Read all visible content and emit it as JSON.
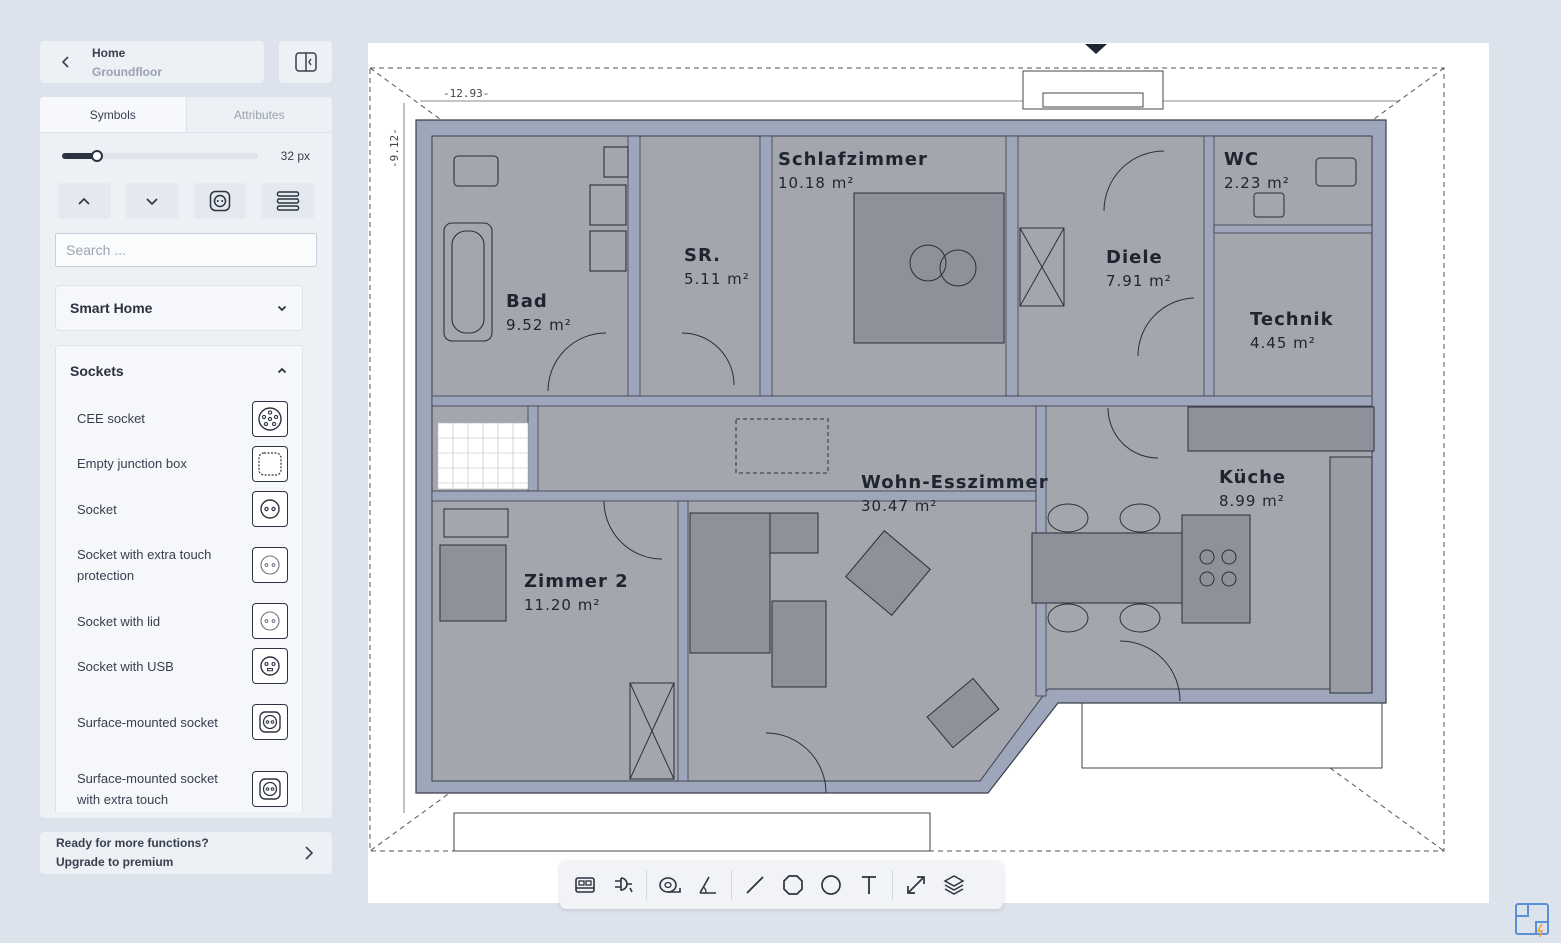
{
  "header": {
    "title": "Home",
    "subtitle": "Groundfloor"
  },
  "tabs": [
    {
      "label": "Symbols"
    },
    {
      "label": "Attributes"
    }
  ],
  "size_slider": {
    "value_label": "32 px",
    "level": 0.18
  },
  "search": {
    "placeholder": "Search ..."
  },
  "groups": {
    "smart_home": {
      "label": "Smart Home"
    },
    "sockets": {
      "label": "Sockets",
      "items": [
        {
          "label": "CEE socket"
        },
        {
          "label": "Empty junction box"
        },
        {
          "label": "Socket"
        },
        {
          "label": "Socket with extra touch protection"
        },
        {
          "label": "Socket with lid"
        },
        {
          "label": "Socket with USB"
        },
        {
          "label": "Surface-mounted socket"
        },
        {
          "label": "Surface-mounted socket with extra touch"
        }
      ]
    }
  },
  "upgrade": {
    "line1": "Ready for more functions?",
    "line2": "Upgrade to premium"
  },
  "floorplan": {
    "dimension_width": "-12.93-",
    "dimension_height": "-9.12-",
    "rooms": [
      {
        "name": "Schlafzimmer",
        "area": "10.18 m²"
      },
      {
        "name": "WC",
        "area": "2.23 m²"
      },
      {
        "name": "SR.",
        "area": "5.11 m²"
      },
      {
        "name": "Diele",
        "area": "7.91 m²"
      },
      {
        "name": "Bad",
        "area": "9.52 m²"
      },
      {
        "name": "Technik",
        "area": "4.45 m²"
      },
      {
        "name": "Küche",
        "area": "8.99 m²"
      },
      {
        "name": "Wohn-Esszimmer",
        "area": "30.47 m²"
      },
      {
        "name": "Zimmer 2",
        "area": "11.20 m²"
      }
    ]
  },
  "colors": {
    "background": "#dde3ec",
    "panel": "#edf0f5",
    "wall": "#9ea6bc",
    "room_fill": "#9a9ca4"
  }
}
